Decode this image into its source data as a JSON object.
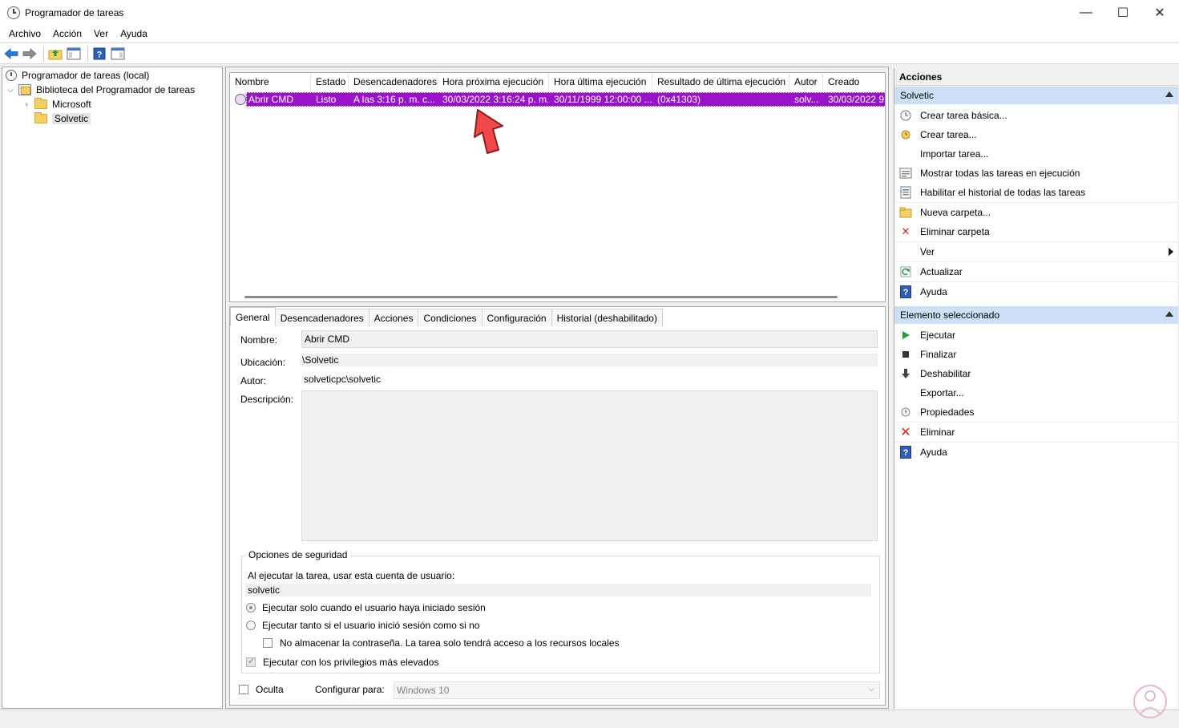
{
  "window": {
    "title": "Programador de tareas",
    "minimize": "—",
    "maximize": "☐",
    "close": "✕"
  },
  "menu": [
    "Archivo",
    "Acción",
    "Ver",
    "Ayuda"
  ],
  "toolbar": {
    "icons": [
      "back-arrow-icon",
      "forward-arrow-icon",
      "folder-up-icon",
      "show-hide-console-tree-icon",
      "help-icon",
      "action-pane-icon"
    ]
  },
  "tree": {
    "root": "Programador de tareas (local)",
    "library": "Biblioteca del Programador de tareas",
    "microsoft": "Microsoft",
    "solvetic": "Solvetic"
  },
  "task_list": {
    "columns": [
      "Nombre",
      "Estado",
      "Desencadenadores",
      "Hora próxima ejecución",
      "Hora última ejecución",
      "Resultado de última ejecución",
      "Autor",
      "Creado"
    ],
    "rows": [
      {
        "name": "Abrir CMD",
        "status": "Listo",
        "triggers": "A las 3:16 p. m. c...",
        "next_run": "30/03/2022 3:16:24 p. m.",
        "last_run": "30/11/1999 12:00:00 ...",
        "last_result": "(0x41303)",
        "author": "solv...",
        "created": "30/03/2022 9:"
      }
    ],
    "selected_color": "#9b13c8"
  },
  "detail": {
    "tabs": [
      "General",
      "Desencadenadores",
      "Acciones",
      "Condiciones",
      "Configuración",
      "Historial (deshabilitado)"
    ],
    "name_label": "Nombre:",
    "name_value": "Abrir CMD",
    "location_label": "Ubicación:",
    "location_value": "\\Solvetic",
    "author_label": "Autor:",
    "author_value": "solveticpc\\solvetic",
    "description_label": "Descripción:",
    "security": {
      "title": "Opciones de seguridad",
      "account_label": "Al ejecutar la tarea, usar esta cuenta de usuario:",
      "account_value": "solvetic",
      "option_logged_on": "Ejecutar solo cuando el usuario haya iniciado sesión",
      "option_whether": "Ejecutar tanto si el usuario inició sesión como si no",
      "option_no_password": "No almacenar la contraseña. La tarea solo tendrá acceso a los recursos locales",
      "option_highest": "Ejecutar con los privilegios más elevados"
    },
    "hidden_label": "Oculta",
    "configure_label": "Configurar para:",
    "configure_value": "Windows 10"
  },
  "actions": {
    "title": "Acciones",
    "section_folder": "Solvetic",
    "folder_items": [
      "Crear tarea básica...",
      "Crear tarea...",
      "Importar tarea...",
      "Mostrar todas las tareas en ejecución",
      "Habilitar el historial de todas las tareas",
      "Nueva carpeta...",
      "Eliminar carpeta",
      "Ver",
      "Actualizar",
      "Ayuda"
    ],
    "section_selected": "Elemento seleccionado",
    "selected_items": [
      "Ejecutar",
      "Finalizar",
      "Deshabilitar",
      "Exportar...",
      "Propiedades",
      "Eliminar",
      "Ayuda"
    ]
  },
  "colors": {
    "accent_header": "#cde0f7",
    "selection": "#9b13c8",
    "annotation_arrow": "#f2484b"
  }
}
